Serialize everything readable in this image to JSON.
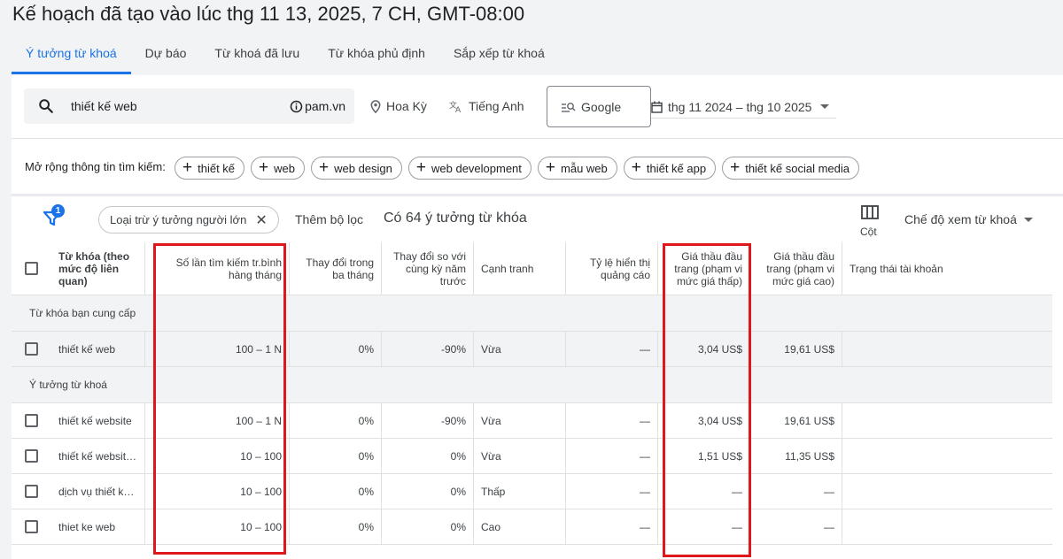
{
  "page_title": "Kế hoạch đã tạo vào lúc thg 11 13, 2025, 7 CH, GMT-08:00",
  "tabs": [
    {
      "label": "Ý tưởng từ khoá",
      "active": true
    },
    {
      "label": "Dự báo",
      "active": false
    },
    {
      "label": "Từ khoá đã lưu",
      "active": false
    },
    {
      "label": "Từ khóa phủ định",
      "active": false
    },
    {
      "label": "Sắp xếp từ khoá",
      "active": false
    }
  ],
  "search": {
    "query": "thiết kế web",
    "site": "pam.vn",
    "icon": "search-icon"
  },
  "filters": {
    "location": "Hoa Kỳ",
    "language": "Tiếng Anh",
    "network": "Google",
    "date_range": "thg 11 2024 – thg 10 2025"
  },
  "expand": {
    "label": "Mở rộng thông tin tìm kiếm:",
    "chips": [
      "thiết kế",
      "web",
      "web design",
      "web development",
      "mẫu web",
      "thiết kế app",
      "thiết kế social media"
    ]
  },
  "toolbar": {
    "filter_count": "1",
    "exclude_chip": "Loại trừ ý tưởng người lớn",
    "add_filter": "Thêm bộ lọc",
    "idea_count": "Có 64 ý tưởng từ khóa",
    "columns_label": "Cột",
    "view_mode": "Chế độ xem từ khoá"
  },
  "table": {
    "headers": [
      "Từ khóa (theo mức độ liên quan)",
      "Số lần tìm kiếm tr.bình hàng tháng",
      "Thay đổi trong ba tháng",
      "Thay đổi so với cùng kỳ năm trước",
      "Cạnh tranh",
      "Tỷ lệ hiển thị quảng cáo",
      "Giá thầu đầu trang (phạm vi mức giá thấp)",
      "Giá thầu đầu trang (phạm vi mức giá cao)",
      "Trạng thái tài khoản"
    ],
    "group_provided": "Từ khóa bạn cung cấp",
    "provided_rows": [
      {
        "keyword": "thiết kế web",
        "searches": "100 – 1 N",
        "three_month": "0%",
        "yoy": "-90%",
        "competition": "Vừa",
        "impr_share": "—",
        "bid_low": "3,04 US$",
        "bid_high": "19,61 US$",
        "status": ""
      }
    ],
    "group_ideas": "Ý tưởng từ khoá",
    "idea_rows": [
      {
        "keyword": "thiết kế website",
        "searches": "100 – 1 N",
        "three_month": "0%",
        "yoy": "-90%",
        "competition": "Vừa",
        "impr_share": "—",
        "bid_low": "3,04 US$",
        "bid_high": "19,61 US$",
        "status": ""
      },
      {
        "keyword": "thiết kế websit…",
        "searches": "10 – 100",
        "three_month": "0%",
        "yoy": "0%",
        "competition": "Vừa",
        "impr_share": "—",
        "bid_low": "1,51 US$",
        "bid_high": "11,35 US$",
        "status": ""
      },
      {
        "keyword": "dịch vụ thiết k…",
        "searches": "10 – 100",
        "three_month": "0%",
        "yoy": "0%",
        "competition": "Thấp",
        "impr_share": "—",
        "bid_low": "—",
        "bid_high": "—",
        "status": ""
      },
      {
        "keyword": "thiet ke web",
        "searches": "10 – 100",
        "three_month": "0%",
        "yoy": "0%",
        "competition": "Cao",
        "impr_share": "—",
        "bid_low": "—",
        "bid_high": "—",
        "status": ""
      }
    ]
  },
  "colors": {
    "accent": "#1a73e8",
    "highlight_box": "#e0161d"
  }
}
